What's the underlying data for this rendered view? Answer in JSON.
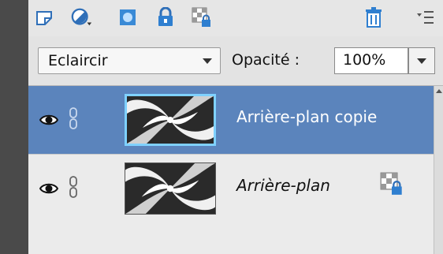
{
  "toolbar": {
    "icons": [
      "new-layer-icon",
      "adjustment-layer-icon",
      "layer-mask-icon",
      "lock-all-icon",
      "lock-transparency-icon",
      "trash-icon",
      "panel-menu-icon"
    ]
  },
  "blend_mode": {
    "selected": "Eclaircir"
  },
  "opacity": {
    "label": "Opacité :",
    "value": "100%"
  },
  "layers": [
    {
      "name": "Arrière-plan copie",
      "selected": true,
      "visible": true,
      "locked": false
    },
    {
      "name": "Arrière-plan",
      "selected": false,
      "visible": true,
      "locked": true
    }
  ],
  "colors": {
    "selection": "#5b84bc",
    "thumb_highlight": "#7fd1ff",
    "icon_blue": "#2f7fd0"
  }
}
